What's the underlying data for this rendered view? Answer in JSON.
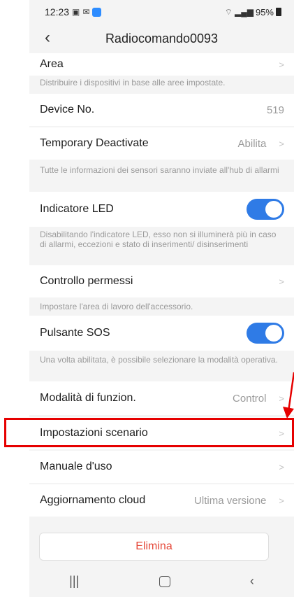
{
  "status": {
    "time": "12:23",
    "battery": "95%"
  },
  "header": {
    "title": "Radiocomando0093"
  },
  "rows": {
    "area": {
      "label": "Area"
    },
    "area_desc": "Distribuire i dispositivi in base alle aree impostate.",
    "device_no": {
      "label": "Device No.",
      "value": "519"
    },
    "temp_deact": {
      "label": "Temporary Deactivate",
      "value": "Abilita"
    },
    "temp_desc": "Tutte le informazioni dei sensori saranno inviate all'hub di allarmi",
    "led": {
      "label": "Indicatore LED",
      "state": "on"
    },
    "led_desc": "Disabilitando l'indicatore LED, esso non si illuminerà più in caso di allarmi, eccezioni e stato di inserimenti/ disinserimenti",
    "permessi": {
      "label": "Controllo permessi"
    },
    "permessi_desc": "Impostare l'area di lavoro dell'accessorio.",
    "sos": {
      "label": "Pulsante SOS",
      "state": "on"
    },
    "sos_desc": "Una volta abilitata, è possibile selezionare la modalità operativa.",
    "modalita": {
      "label": "Modalità di funzion.",
      "value": "Control"
    },
    "scenario": {
      "label": "Impostazioni scenario"
    },
    "manuale": {
      "label": "Manuale d'uso"
    },
    "cloud": {
      "label": "Aggiornamento cloud",
      "value": "Ultima versione"
    }
  },
  "actions": {
    "delete_label": "Elimina"
  },
  "colors": {
    "toggle_on": "#2f7be6",
    "delete_text": "#e5493a",
    "highlight": "#e60000"
  }
}
